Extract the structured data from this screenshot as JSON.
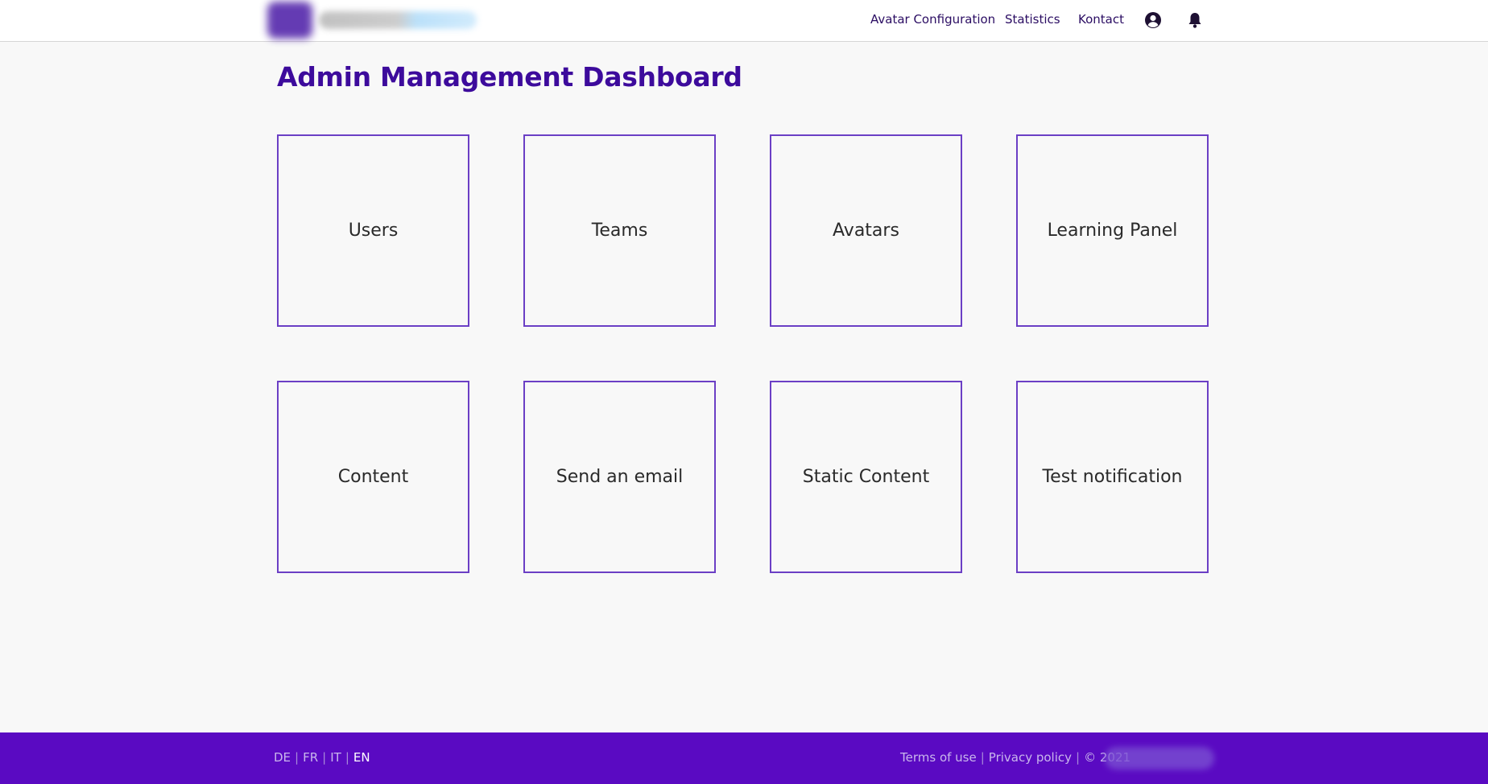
{
  "header": {
    "nav": [
      {
        "label": "Avatar Configuration"
      },
      {
        "label": "Statistics"
      },
      {
        "label": "Kontact"
      }
    ],
    "icons": [
      "user-circle-icon",
      "bell-icon"
    ]
  },
  "main": {
    "title": "Admin Management Dashboard",
    "tiles": [
      {
        "label": "Users"
      },
      {
        "label": "Teams"
      },
      {
        "label": "Avatars"
      },
      {
        "label": "Learning Panel"
      },
      {
        "label": "Content"
      },
      {
        "label": "Send an email"
      },
      {
        "label": "Static Content"
      },
      {
        "label": "Test notification"
      }
    ]
  },
  "footer": {
    "languages": [
      {
        "label": "DE",
        "active": false
      },
      {
        "label": "FR",
        "active": false
      },
      {
        "label": "IT",
        "active": false
      },
      {
        "label": "EN",
        "active": true
      }
    ],
    "terms": "Terms of use",
    "privacy": "Privacy policy",
    "copyright": "© 2021"
  },
  "colors": {
    "accent": "#3d0b9c",
    "tile_border": "#6b3fc5",
    "footer_bg": "#5a0ac2",
    "background": "#f8f8f8"
  }
}
